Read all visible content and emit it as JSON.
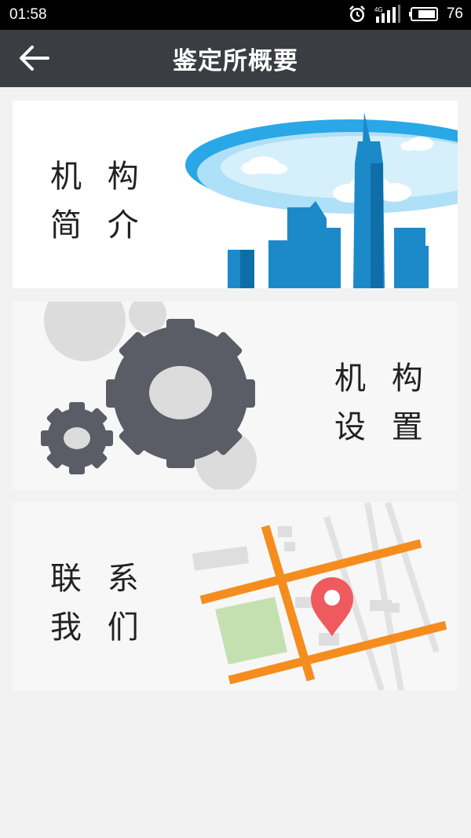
{
  "status_bar": {
    "time": "01:58",
    "network": "4G",
    "battery": "76",
    "icons": [
      "alarm-icon",
      "signal-icon",
      "battery-icon"
    ]
  },
  "app_bar": {
    "title": "鉴定所概要",
    "back_icon": "arrow-left-icon"
  },
  "cards": [
    {
      "line1": "机 构",
      "line2": "简 介",
      "icon": "city-skyline-illustration"
    },
    {
      "line1": "机 构",
      "line2": "设 置",
      "icon": "gears-illustration"
    },
    {
      "line1": "联 系",
      "line2": "我 们",
      "icon": "map-pin-illustration"
    }
  ],
  "colors": {
    "status_bar": "#000000",
    "app_bar": "#3a3d41",
    "background": "#f2f2f2",
    "city_blue": "#1c8ac9",
    "gear_gray": "#5a5d66",
    "road_orange": "#f58d1e",
    "pin_red": "#ee5a5e",
    "park_green": "#c4e0b0"
  }
}
